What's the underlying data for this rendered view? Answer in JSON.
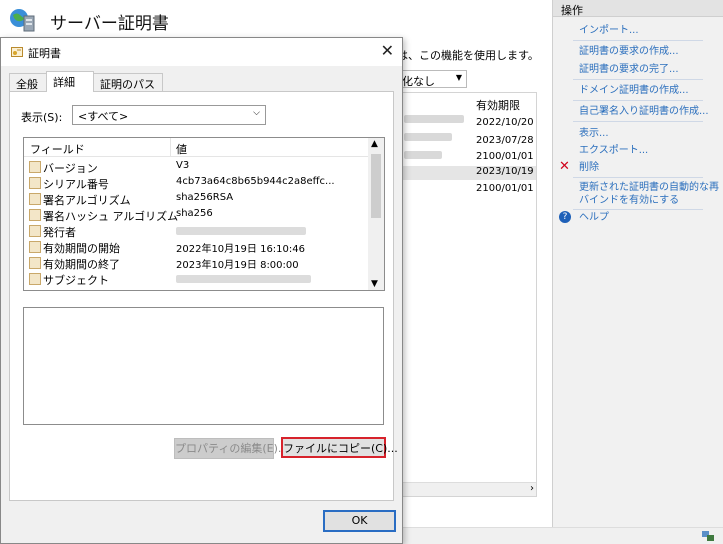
{
  "background": {
    "title": "サーバー証明書",
    "description": "は、この機能を使用します。",
    "filter_value": "化なし",
    "list_header": "有効期限",
    "dates": [
      "2022/10/20 1",
      "2023/07/28 1",
      "2100/01/01 0",
      "2023/10/19 8",
      "2100/01/01 0"
    ]
  },
  "actions": {
    "header": "操作",
    "import": "インポート...",
    "create_request": "証明書の要求の作成...",
    "complete_request": "証明書の要求の完了...",
    "domain_cert": "ドメイン証明書の作成...",
    "self_signed": "自己署名入り証明書の作成...",
    "view": "表示...",
    "export": "エクスポート...",
    "remove": "削除",
    "auto_rebind": "更新された証明書の自動的な再",
    "auto_rebind_2": "バインドを有効にする",
    "help": "ヘルプ"
  },
  "dialog": {
    "title": "証明書",
    "tabs": [
      {
        "label": "全般"
      },
      {
        "label": "詳細"
      },
      {
        "label": "証明のパス"
      }
    ],
    "show_label": "表示(S):",
    "show_value": "<すべて>",
    "field_header": "フィールド",
    "value_header": "値",
    "fields": [
      {
        "name": "バージョン",
        "value": "V3"
      },
      {
        "name": "シリアル番号",
        "value": "4cb73a64c8b65b944c2a8effc..."
      },
      {
        "name": "署名アルゴリズム",
        "value": "sha256RSA"
      },
      {
        "name": "署名ハッシュ アルゴリズム",
        "value": "sha256"
      },
      {
        "name": "発行者",
        "value": ""
      },
      {
        "name": "有効期間の開始",
        "value": "2022年10月19日 16:10:46"
      },
      {
        "name": "有効期間の終了",
        "value": "2023年10月19日 8:00:00"
      },
      {
        "name": "サブジェクト",
        "value": ""
      }
    ],
    "edit_properties": "プロパティの編集(E)...",
    "copy_to_file": "ファイルにコピー(C)...",
    "ok": "OK"
  }
}
